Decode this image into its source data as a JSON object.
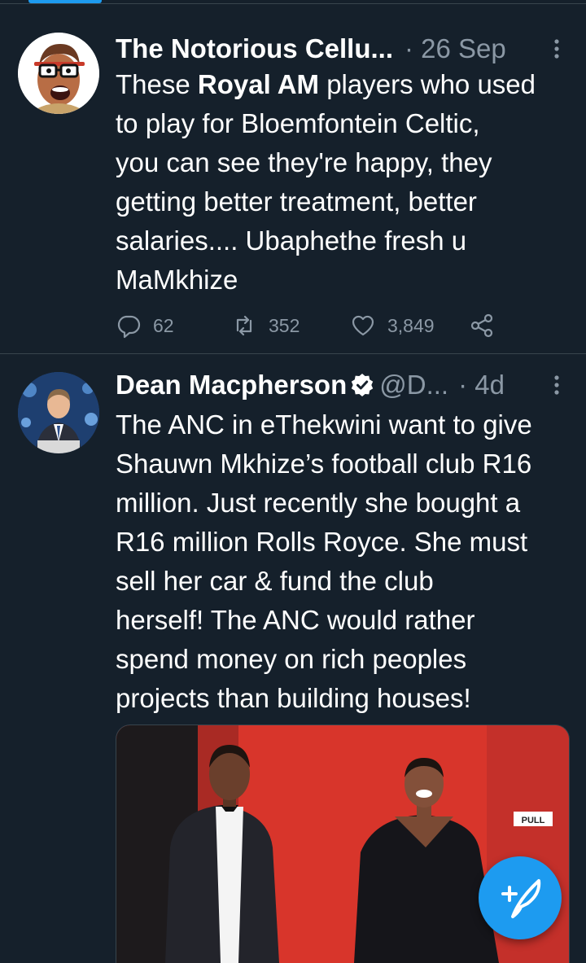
{
  "tweets": [
    {
      "author_name": "The Notorious Cellu...",
      "handle": "",
      "time": "· 26 Sep",
      "text_lines": [
        [
          {
            "t": "These "
          },
          {
            "t": "Royal AM",
            "b": true
          },
          {
            "t": " players who used"
          }
        ],
        [
          {
            "t": "to play for Bloemfontein Celtic,"
          }
        ],
        [
          {
            "t": "you can see they're happy, they"
          }
        ],
        [
          {
            "t": "getting better treatment, better"
          }
        ],
        [
          {
            "t": "salaries.... Ubaphethe fresh u"
          }
        ],
        [
          {
            "t": "MaMkhize"
          }
        ]
      ],
      "counts": {
        "replies": "62",
        "retweets": "352",
        "likes": "3,849"
      }
    },
    {
      "author_name": "Dean Macpherson",
      "handle": "@D...",
      "time": "· 4d",
      "text_lines": [
        [
          {
            "t": "The ANC in eThekwini want to give"
          }
        ],
        [
          {
            "t": "Shauwn Mkhize’s football club R16"
          }
        ],
        [
          {
            "t": "million. Just recently she bought a"
          }
        ],
        [
          {
            "t": "R16 million Rolls Royce. She must"
          }
        ],
        [
          {
            "t": "sell her car & fund the club"
          }
        ],
        [
          {
            "t": "herself! The ANC would rather"
          }
        ],
        [
          {
            "t": "spend money on rich peoples"
          }
        ],
        [
          {
            "t": "projects than building houses!"
          }
        ]
      ],
      "media_sign": "PULL"
    }
  ],
  "icons": {
    "reply": "reply-icon",
    "retweet": "retweet-icon",
    "like": "heart-icon",
    "share": "share-icon",
    "more": "more-vertical-icon",
    "verified": "verified-badge-icon",
    "compose": "compose-tweet-icon"
  },
  "colors": {
    "background": "#15202b",
    "accent": "#1d9bf0",
    "muted": "#8b98a5",
    "divider": "#38444d"
  }
}
